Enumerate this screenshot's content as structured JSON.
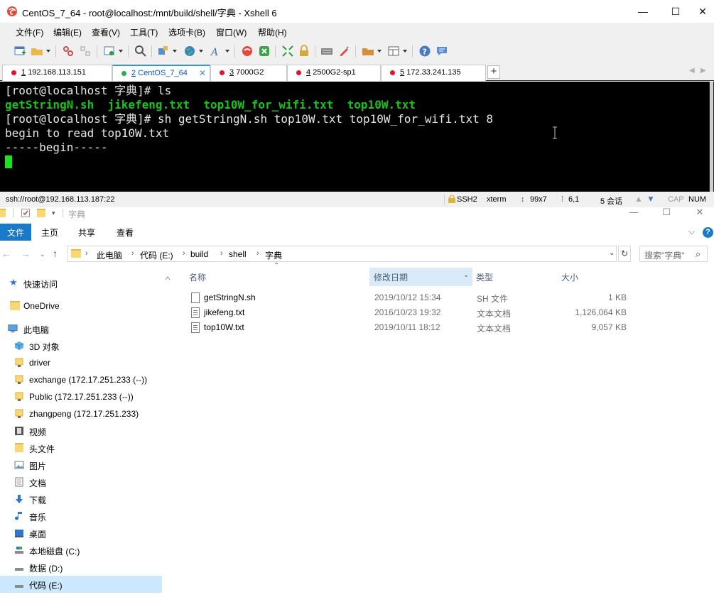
{
  "xshell": {
    "title": "CentOS_7_64 - root@localhost:/mnt/build/shell/字典 - Xshell 6",
    "window_controls": {
      "minimize": "—",
      "maximize": "☐",
      "close": "✕"
    },
    "menu": [
      "文件(F)",
      "编辑(E)",
      "查看(V)",
      "工具(T)",
      "选项卡(B)",
      "窗口(W)",
      "帮助(H)"
    ],
    "tabs": [
      {
        "num": "1",
        "label": "192.168.113.151",
        "active": false
      },
      {
        "num": "2",
        "label": "CentOS_7_64",
        "active": true
      },
      {
        "num": "3",
        "label": "7000G2",
        "active": false
      },
      {
        "num": "4",
        "label": "2500G2-sp1",
        "active": false
      },
      {
        "num": "5",
        "label": "172.33.241.135",
        "active": false
      }
    ],
    "tab_add": "+",
    "tab_nav": [
      "◀",
      "▶"
    ],
    "terminal": {
      "line1": "[root@localhost 字典]# ls",
      "ls_output": [
        "getStringN.sh",
        "jikefeng.txt",
        "top10W_for_wifi.txt",
        "top10W.txt"
      ],
      "line3": "[root@localhost 字典]# sh getStringN.sh top10W.txt top10W_for_wifi.txt 8",
      "line4": "begin to read top10W.txt",
      "line5": "-----begin-----"
    },
    "status": {
      "connection": "ssh://root@192.168.113.187:22",
      "protocol": "SSH2",
      "term_type": "xterm",
      "size": "99x7",
      "position": "6,1",
      "sessions": "5 会话",
      "caps": "CAP",
      "num": "NUM"
    },
    "colors": {
      "terminal_bg": "#000000",
      "terminal_green": "#17c41a",
      "active_tab": "#0b55c4"
    }
  },
  "explorer": {
    "title": "字典",
    "ribbon_tabs": [
      "文件",
      "主页",
      "共享",
      "查看"
    ],
    "breadcrumb": [
      "此电脑",
      "代码 (E:)",
      "build",
      "shell",
      "字典"
    ],
    "search_placeholder": "搜索\"字典\"",
    "nav_items": [
      {
        "label": "快速访问",
        "icon": "star-icon"
      },
      {
        "label": "OneDrive",
        "icon": "folder-icon"
      },
      {
        "label": "此电脑",
        "icon": "computer-icon"
      },
      {
        "label": "3D 对象",
        "icon": "cube-icon"
      },
      {
        "label": "driver",
        "icon": "network-folder-icon"
      },
      {
        "label": "exchange (172.17.251.233 (--))",
        "icon": "network-folder-icon"
      },
      {
        "label": "Public (172.17.251.233 (--))",
        "icon": "network-folder-icon"
      },
      {
        "label": "zhangpeng (172.17.251.233)",
        "icon": "network-folder-icon"
      },
      {
        "label": "视频",
        "icon": "video-icon"
      },
      {
        "label": "头文件",
        "icon": "folder-icon"
      },
      {
        "label": "图片",
        "icon": "picture-icon"
      },
      {
        "label": "文档",
        "icon": "document-icon"
      },
      {
        "label": "下载",
        "icon": "download-icon"
      },
      {
        "label": "音乐",
        "icon": "music-icon"
      },
      {
        "label": "桌面",
        "icon": "desktop-icon"
      },
      {
        "label": "本地磁盘 (C:)",
        "icon": "drive-icon"
      },
      {
        "label": "数据 (D:)",
        "icon": "drive-icon"
      },
      {
        "label": "代码 (E:)",
        "icon": "drive-icon"
      }
    ],
    "columns": [
      "名称",
      "修改日期",
      "类型",
      "大小"
    ],
    "files": [
      {
        "name": "getStringN.sh",
        "date": "2019/10/12 15:34",
        "type": "SH 文件",
        "size": "1 KB"
      },
      {
        "name": "jikefeng.txt",
        "date": "2016/10/23 19:32",
        "type": "文本文档",
        "size": "1,126,064 KB"
      },
      {
        "name": "top10W.txt",
        "date": "2019/10/11 18:12",
        "type": "文本文档",
        "size": "9,057 KB"
      }
    ]
  }
}
